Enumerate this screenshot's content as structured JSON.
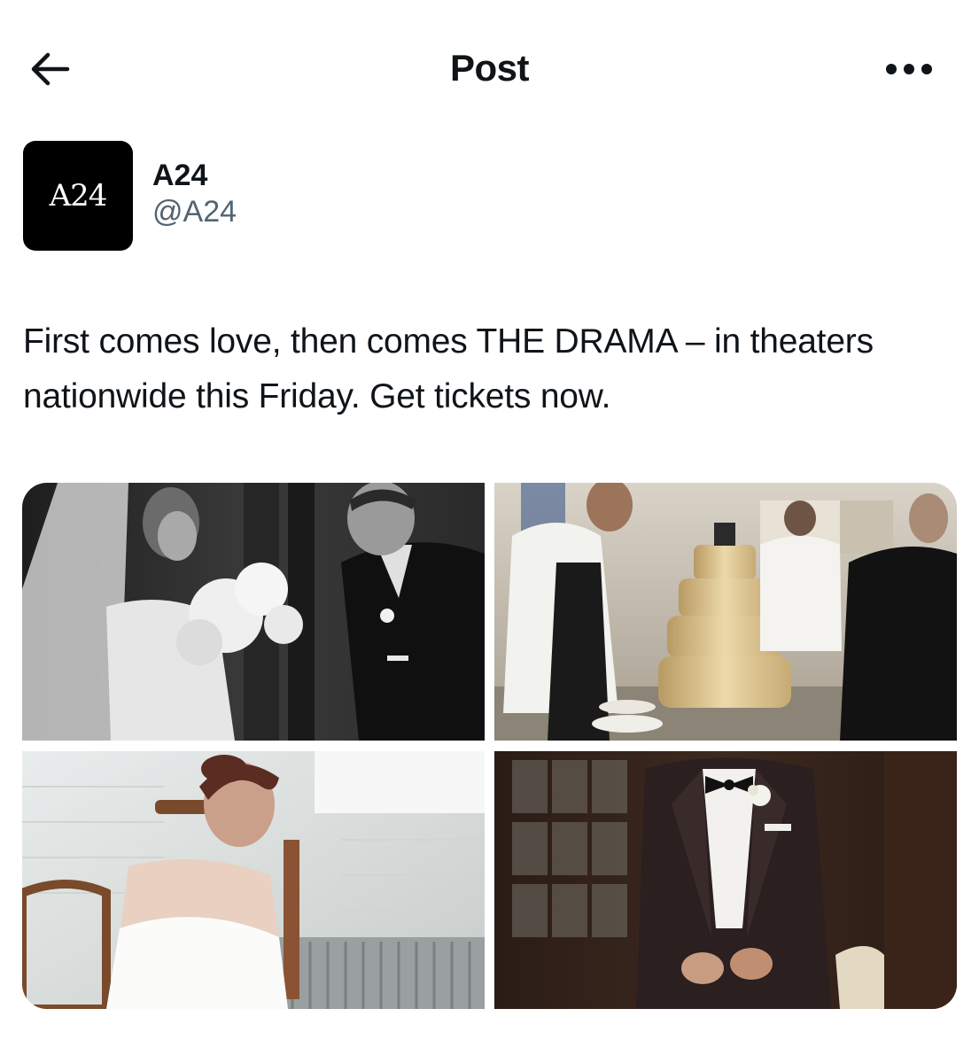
{
  "header": {
    "title": "Post",
    "back_icon": "arrow-left-icon",
    "more_icon": "more-horizontal-icon"
  },
  "author": {
    "avatar_text": "A24",
    "display_name": "A24",
    "handle": "@A24"
  },
  "post": {
    "text": "First comes love, then comes THE DRAMA – in theaters nationwide this Friday. Get tickets now."
  },
  "media": [
    {
      "name": "photo-wedding-couple",
      "tone": "monochrome"
    },
    {
      "name": "photo-kitchen-cake",
      "tone": "warm"
    },
    {
      "name": "photo-bride-seated",
      "tone": "cool"
    },
    {
      "name": "photo-groom-tuxedo",
      "tone": "dark"
    }
  ],
  "colors": {
    "text_primary": "#0f1419",
    "text_secondary": "#536471",
    "avatar_bg": "#000000"
  }
}
